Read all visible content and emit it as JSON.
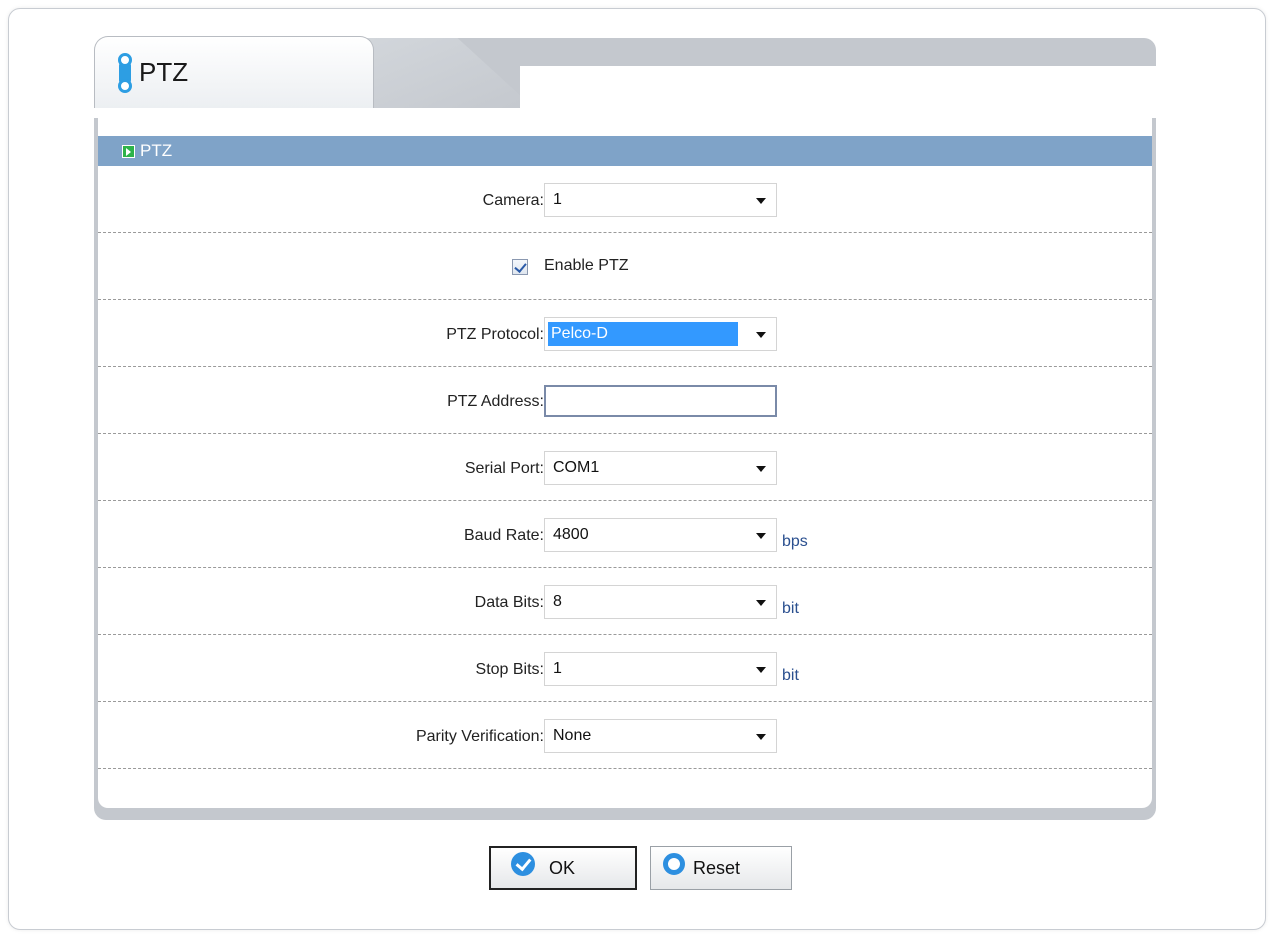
{
  "tab": {
    "title": "PTZ",
    "icon": "ptz-tab-icon"
  },
  "section": {
    "title": "PTZ",
    "icon": "green-arrow-icon"
  },
  "fields": {
    "camera": {
      "label": "Camera:",
      "value": "1"
    },
    "enable_ptz": {
      "label": "Enable PTZ",
      "checked": true
    },
    "protocol": {
      "label": "PTZ Protocol:",
      "value": "Pelco-D"
    },
    "address": {
      "label": "PTZ Address:",
      "value": ""
    },
    "serial_port": {
      "label": "Serial Port:",
      "value": "COM1"
    },
    "baud_rate": {
      "label": "Baud Rate:",
      "value": "4800",
      "unit": "bps"
    },
    "data_bits": {
      "label": "Data Bits:",
      "value": "8",
      "unit": "bit"
    },
    "stop_bits": {
      "label": "Stop Bits:",
      "value": "1",
      "unit": "bit"
    },
    "parity": {
      "label": "Parity Verification:",
      "value": "None"
    }
  },
  "buttons": {
    "ok": "OK",
    "reset": "Reset"
  },
  "colors": {
    "header": "#7fa3c8",
    "accent": "#2d8fe0",
    "selection": "#3399ff",
    "unit_text": "#2a4f8f"
  }
}
